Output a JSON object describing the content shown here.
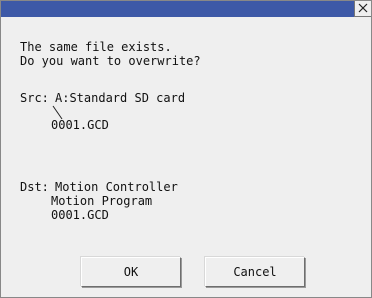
{
  "dialog": {
    "message_line1": "The same file exists.",
    "message_line2": "Do you want to overwrite?",
    "src_label": "Src:",
    "src_device": "A:Standard SD card",
    "src_file": "0001.GCD",
    "dst_label": "Dst:",
    "dst_device": "Motion Controller",
    "dst_folder": "Motion Program",
    "dst_file": "0001.GCD",
    "ok_label": "OK",
    "cancel_label": "Cancel"
  },
  "colors": {
    "titlebar": "#3d59a7",
    "background": "#efefef"
  },
  "icons": {
    "close": "close-icon"
  }
}
